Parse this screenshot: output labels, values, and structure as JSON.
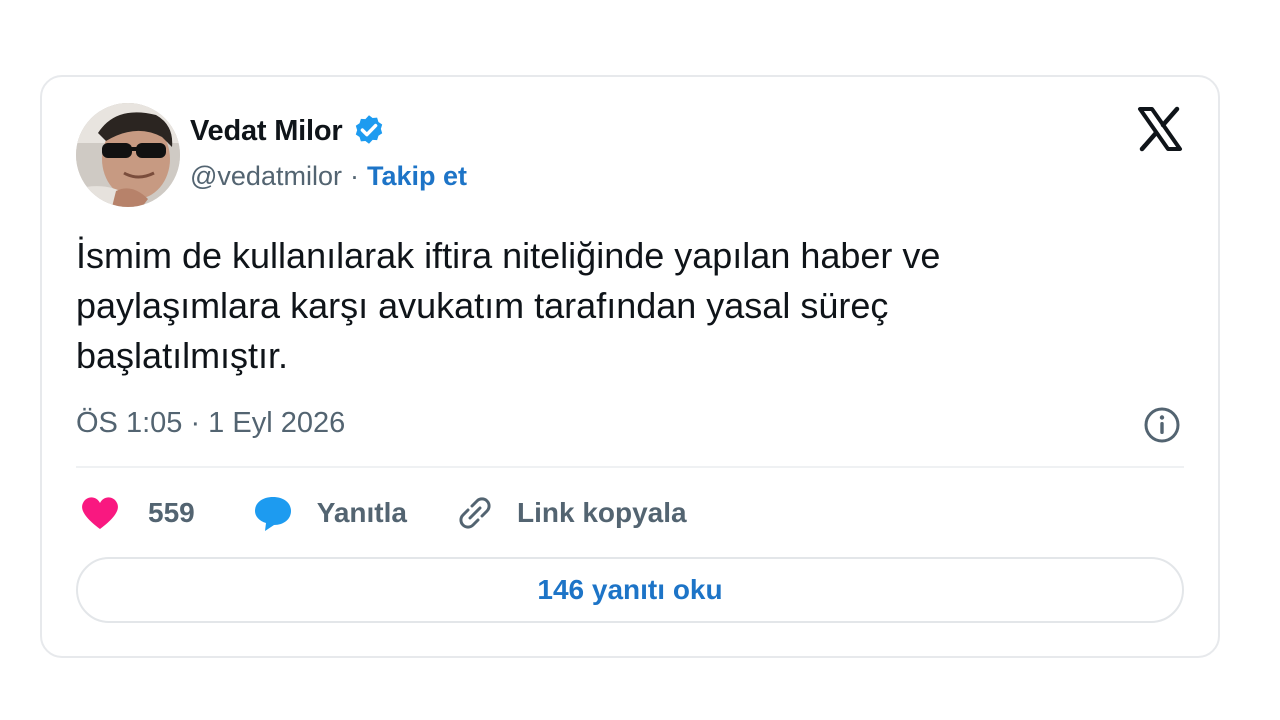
{
  "author": {
    "name": "Vedat Milor",
    "handle": "@vedatmilor",
    "separator": "·",
    "follow_label": "Takip et"
  },
  "tweet": {
    "text_lines": [
      "İsmim de kullanılarak iftira niteliğinde yapılan haber ve",
      "paylaşımlara karşı avukatım tarafından yasal süreç",
      "başlatılmıştır."
    ],
    "timestamp": "ÖS 1:05 · 1 Eyl 2026"
  },
  "actions": {
    "likes": "559",
    "reply_label": "Yanıtla",
    "copy_link_label": "Link kopyala"
  },
  "replies_button": "146 yanıtı oku",
  "icons": {
    "verified": "verified-badge-icon",
    "logo": "x-logo-icon",
    "info": "info-icon",
    "heart": "heart-icon",
    "reply": "reply-bubble-icon",
    "link": "link-icon"
  },
  "colors": {
    "accent": "#1d74c7",
    "verified": "#1d9bf0",
    "heart": "#f91880",
    "text": "#0f1419",
    "muted": "#536471"
  }
}
